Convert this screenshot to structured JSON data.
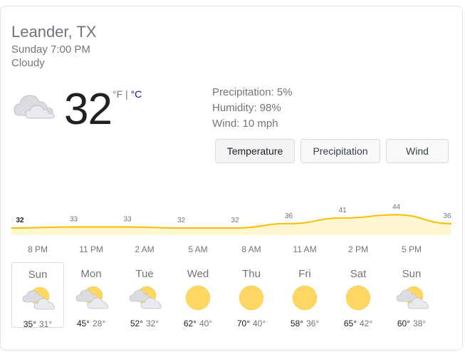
{
  "location": "Leander, TX",
  "time": "Sunday 7:00 PM",
  "condition": "Cloudy",
  "current": {
    "temp": "32",
    "unit_f": "°F",
    "separator": " | ",
    "unit_c": "°C",
    "icon": "cloudy-icon"
  },
  "details": {
    "precipitation": "Precipitation: 5%",
    "humidity": "Humidity: 98%",
    "wind": "Wind: 10 mph"
  },
  "tabs": [
    {
      "label": "Temperature",
      "active": true
    },
    {
      "label": "Precipitation",
      "active": false
    },
    {
      "label": "Wind",
      "active": false
    }
  ],
  "chart_data": {
    "type": "area",
    "values": [
      32,
      33,
      33,
      32,
      32,
      36,
      41,
      44,
      36
    ],
    "labels": [
      "32",
      "33",
      "33",
      "32",
      "32",
      "36",
      "41",
      "44",
      "36"
    ],
    "x": [
      "8 PM",
      "11 PM",
      "2 AM",
      "5 AM",
      "8 AM",
      "11 AM",
      "2 PM",
      "5 PM",
      ""
    ],
    "ylim": [
      0,
      50
    ],
    "fill_color": "#fef7d0",
    "line_color": "#fbbc04"
  },
  "times": [
    "8 PM",
    "11 PM",
    "2 AM",
    "5 AM",
    "8 AM",
    "11 AM",
    "2 PM",
    "5 PM"
  ],
  "forecast": [
    {
      "day": "Sun",
      "icon": "partly-cloudy-icon",
      "hi": "35°",
      "lo": "31°"
    },
    {
      "day": "Mon",
      "icon": "partly-cloudy-icon",
      "hi": "45°",
      "lo": "28°"
    },
    {
      "day": "Tue",
      "icon": "partly-cloudy-icon",
      "hi": "52°",
      "lo": "32°"
    },
    {
      "day": "Wed",
      "icon": "sunny-icon",
      "hi": "62°",
      "lo": "40°"
    },
    {
      "day": "Thu",
      "icon": "sunny-icon",
      "hi": "70°",
      "lo": "40°"
    },
    {
      "day": "Fri",
      "icon": "sunny-icon",
      "hi": "58°",
      "lo": "36°"
    },
    {
      "day": "Sat",
      "icon": "sunny-icon",
      "hi": "65°",
      "lo": "42°"
    },
    {
      "day": "Sun",
      "icon": "partly-cloudy-icon",
      "hi": "60°",
      "lo": "38°"
    }
  ],
  "colors": {
    "sun": "#fdd663",
    "sun_stroke": "#f9c842",
    "cloud": "#dadce0",
    "cloud_stroke": "#bdc1c6"
  }
}
